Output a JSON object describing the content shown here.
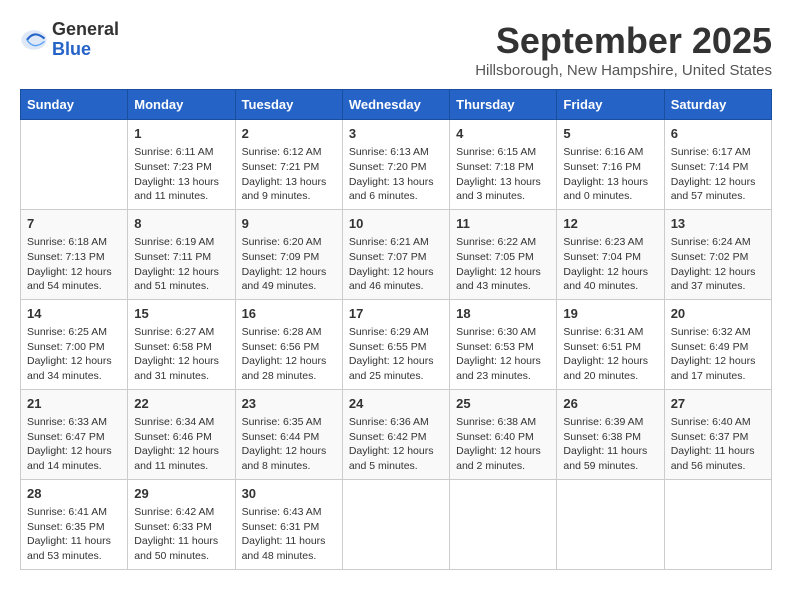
{
  "logo": {
    "line1": "General",
    "line2": "Blue"
  },
  "title": "September 2025",
  "location": "Hillsborough, New Hampshire, United States",
  "days_of_week": [
    "Sunday",
    "Monday",
    "Tuesday",
    "Wednesday",
    "Thursday",
    "Friday",
    "Saturday"
  ],
  "weeks": [
    [
      {
        "day": "",
        "info": ""
      },
      {
        "day": "1",
        "info": "Sunrise: 6:11 AM\nSunset: 7:23 PM\nDaylight: 13 hours\nand 11 minutes."
      },
      {
        "day": "2",
        "info": "Sunrise: 6:12 AM\nSunset: 7:21 PM\nDaylight: 13 hours\nand 9 minutes."
      },
      {
        "day": "3",
        "info": "Sunrise: 6:13 AM\nSunset: 7:20 PM\nDaylight: 13 hours\nand 6 minutes."
      },
      {
        "day": "4",
        "info": "Sunrise: 6:15 AM\nSunset: 7:18 PM\nDaylight: 13 hours\nand 3 minutes."
      },
      {
        "day": "5",
        "info": "Sunrise: 6:16 AM\nSunset: 7:16 PM\nDaylight: 13 hours\nand 0 minutes."
      },
      {
        "day": "6",
        "info": "Sunrise: 6:17 AM\nSunset: 7:14 PM\nDaylight: 12 hours\nand 57 minutes."
      }
    ],
    [
      {
        "day": "7",
        "info": "Sunrise: 6:18 AM\nSunset: 7:13 PM\nDaylight: 12 hours\nand 54 minutes."
      },
      {
        "day": "8",
        "info": "Sunrise: 6:19 AM\nSunset: 7:11 PM\nDaylight: 12 hours\nand 51 minutes."
      },
      {
        "day": "9",
        "info": "Sunrise: 6:20 AM\nSunset: 7:09 PM\nDaylight: 12 hours\nand 49 minutes."
      },
      {
        "day": "10",
        "info": "Sunrise: 6:21 AM\nSunset: 7:07 PM\nDaylight: 12 hours\nand 46 minutes."
      },
      {
        "day": "11",
        "info": "Sunrise: 6:22 AM\nSunset: 7:05 PM\nDaylight: 12 hours\nand 43 minutes."
      },
      {
        "day": "12",
        "info": "Sunrise: 6:23 AM\nSunset: 7:04 PM\nDaylight: 12 hours\nand 40 minutes."
      },
      {
        "day": "13",
        "info": "Sunrise: 6:24 AM\nSunset: 7:02 PM\nDaylight: 12 hours\nand 37 minutes."
      }
    ],
    [
      {
        "day": "14",
        "info": "Sunrise: 6:25 AM\nSunset: 7:00 PM\nDaylight: 12 hours\nand 34 minutes."
      },
      {
        "day": "15",
        "info": "Sunrise: 6:27 AM\nSunset: 6:58 PM\nDaylight: 12 hours\nand 31 minutes."
      },
      {
        "day": "16",
        "info": "Sunrise: 6:28 AM\nSunset: 6:56 PM\nDaylight: 12 hours\nand 28 minutes."
      },
      {
        "day": "17",
        "info": "Sunrise: 6:29 AM\nSunset: 6:55 PM\nDaylight: 12 hours\nand 25 minutes."
      },
      {
        "day": "18",
        "info": "Sunrise: 6:30 AM\nSunset: 6:53 PM\nDaylight: 12 hours\nand 23 minutes."
      },
      {
        "day": "19",
        "info": "Sunrise: 6:31 AM\nSunset: 6:51 PM\nDaylight: 12 hours\nand 20 minutes."
      },
      {
        "day": "20",
        "info": "Sunrise: 6:32 AM\nSunset: 6:49 PM\nDaylight: 12 hours\nand 17 minutes."
      }
    ],
    [
      {
        "day": "21",
        "info": "Sunrise: 6:33 AM\nSunset: 6:47 PM\nDaylight: 12 hours\nand 14 minutes."
      },
      {
        "day": "22",
        "info": "Sunrise: 6:34 AM\nSunset: 6:46 PM\nDaylight: 12 hours\nand 11 minutes."
      },
      {
        "day": "23",
        "info": "Sunrise: 6:35 AM\nSunset: 6:44 PM\nDaylight: 12 hours\nand 8 minutes."
      },
      {
        "day": "24",
        "info": "Sunrise: 6:36 AM\nSunset: 6:42 PM\nDaylight: 12 hours\nand 5 minutes."
      },
      {
        "day": "25",
        "info": "Sunrise: 6:38 AM\nSunset: 6:40 PM\nDaylight: 12 hours\nand 2 minutes."
      },
      {
        "day": "26",
        "info": "Sunrise: 6:39 AM\nSunset: 6:38 PM\nDaylight: 11 hours\nand 59 minutes."
      },
      {
        "day": "27",
        "info": "Sunrise: 6:40 AM\nSunset: 6:37 PM\nDaylight: 11 hours\nand 56 minutes."
      }
    ],
    [
      {
        "day": "28",
        "info": "Sunrise: 6:41 AM\nSunset: 6:35 PM\nDaylight: 11 hours\nand 53 minutes."
      },
      {
        "day": "29",
        "info": "Sunrise: 6:42 AM\nSunset: 6:33 PM\nDaylight: 11 hours\nand 50 minutes."
      },
      {
        "day": "30",
        "info": "Sunrise: 6:43 AM\nSunset: 6:31 PM\nDaylight: 11 hours\nand 48 minutes."
      },
      {
        "day": "",
        "info": ""
      },
      {
        "day": "",
        "info": ""
      },
      {
        "day": "",
        "info": ""
      },
      {
        "day": "",
        "info": ""
      }
    ]
  ]
}
